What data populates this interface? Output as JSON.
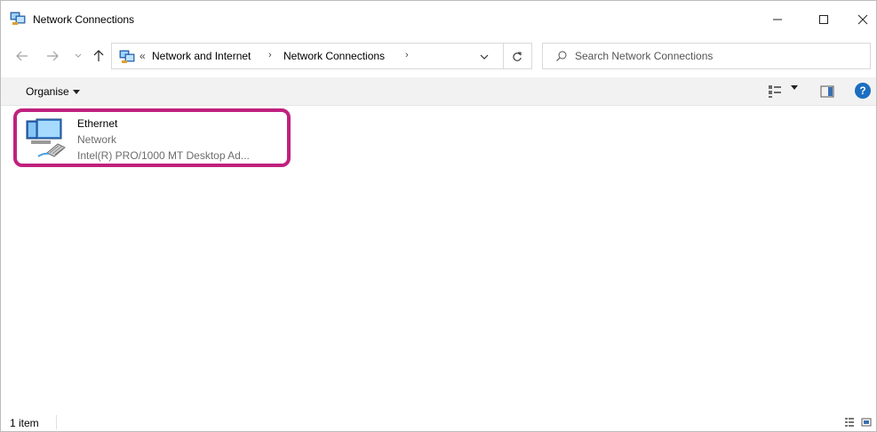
{
  "window": {
    "title": "Network Connections",
    "controls": {
      "minimize": "—",
      "maximize": "☐",
      "close": "✕"
    }
  },
  "address": {
    "overflow": "«",
    "breadcrumbs": [
      "Network and Internet",
      "Network Connections"
    ],
    "separator": "›"
  },
  "search": {
    "placeholder": "Search Network Connections",
    "value": ""
  },
  "commandbar": {
    "organise_label": "Organise",
    "help_label": "?"
  },
  "items": [
    {
      "name": "Ethernet",
      "type": "Network",
      "description": "Intel(R) PRO/1000 MT Desktop Ad..."
    }
  ],
  "status": {
    "count": "1 item"
  },
  "colors": {
    "highlight": "#c0217e",
    "help": "#1b6ec2",
    "commandbar": "#f2f2f2"
  }
}
